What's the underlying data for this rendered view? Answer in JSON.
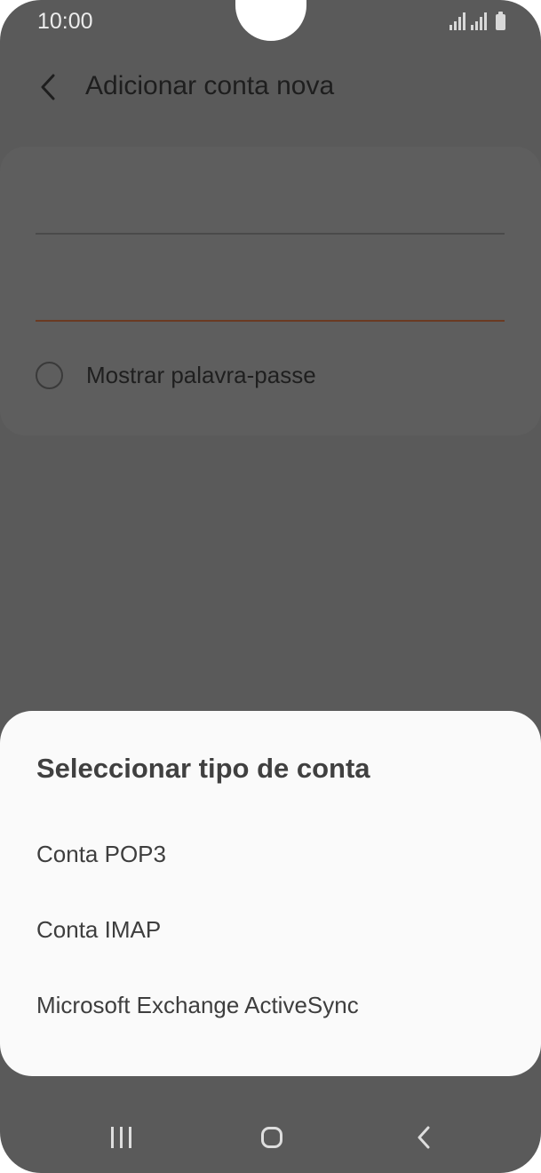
{
  "status_bar": {
    "time": "10:00"
  },
  "app_bar": {
    "back_icon": "chevron-left-icon",
    "title": "Adicionar conta nova"
  },
  "form": {
    "show_password_label": "Mostrar palavra-passe",
    "password_underline_color": "#6a3a22"
  },
  "sheet": {
    "title": "Seleccionar tipo de conta",
    "options": [
      {
        "label": "Conta POP3"
      },
      {
        "label": "Conta IMAP"
      },
      {
        "label": "Microsoft Exchange ActiveSync"
      }
    ]
  },
  "nav_bar": {
    "recent_icon": "recent-apps-icon",
    "home_icon": "home-icon",
    "back_icon": "back-icon"
  },
  "colors": {
    "scrim": "#5a5a5a",
    "sheet_background": "#fafafa"
  }
}
